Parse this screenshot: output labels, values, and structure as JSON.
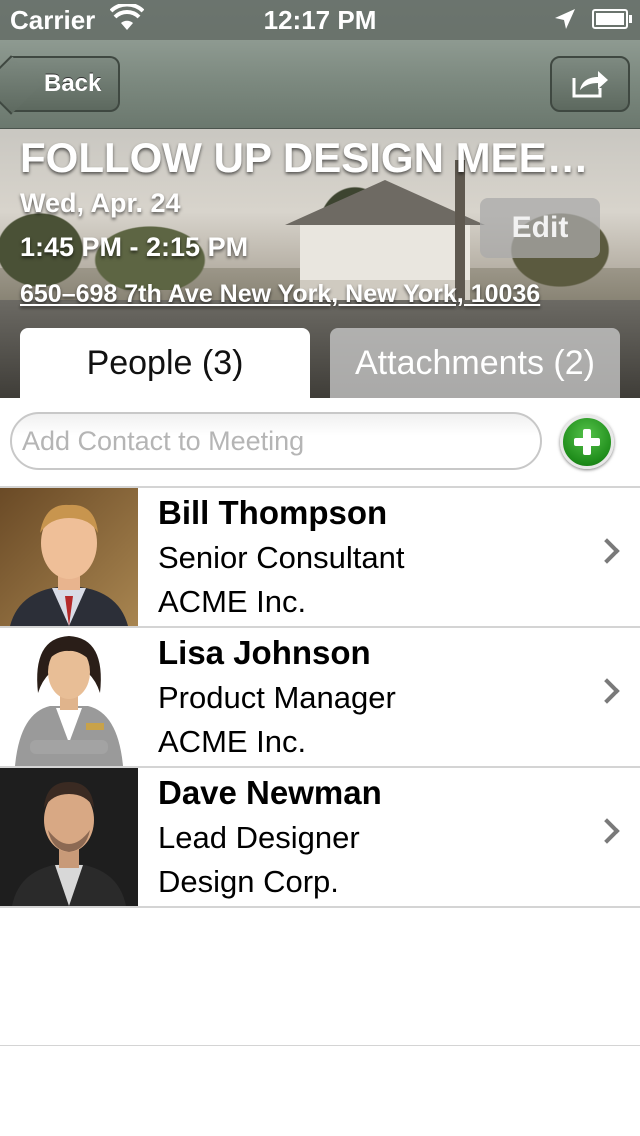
{
  "status_bar": {
    "carrier": "Carrier",
    "time": "12:17 PM"
  },
  "nav": {
    "back_label": "Back",
    "share_icon": "share-icon"
  },
  "meeting": {
    "title": "FOLLOW UP DESIGN MEE…",
    "date": "Wed, Apr. 24",
    "time": "1:45 PM - 2:15 PM",
    "address": "650–698 7th Ave New York, New York, 10036",
    "edit_label": "Edit"
  },
  "tabs": [
    {
      "label": "People (3)",
      "active": true
    },
    {
      "label": "Attachments (2)",
      "active": false
    }
  ],
  "add_contact": {
    "placeholder": "Add Contact to Meeting"
  },
  "contacts": [
    {
      "name": "Bill Thompson",
      "title": "Senior Consultant",
      "company": "ACME Inc."
    },
    {
      "name": "Lisa Johnson",
      "title": "Product Manager",
      "company": "ACME Inc."
    },
    {
      "name": "Dave Newman",
      "title": "Lead Designer",
      "company": "Design Corp."
    }
  ],
  "colors": {
    "accent_green": "#1f8d1b",
    "nav_bar": "#7b887e"
  }
}
